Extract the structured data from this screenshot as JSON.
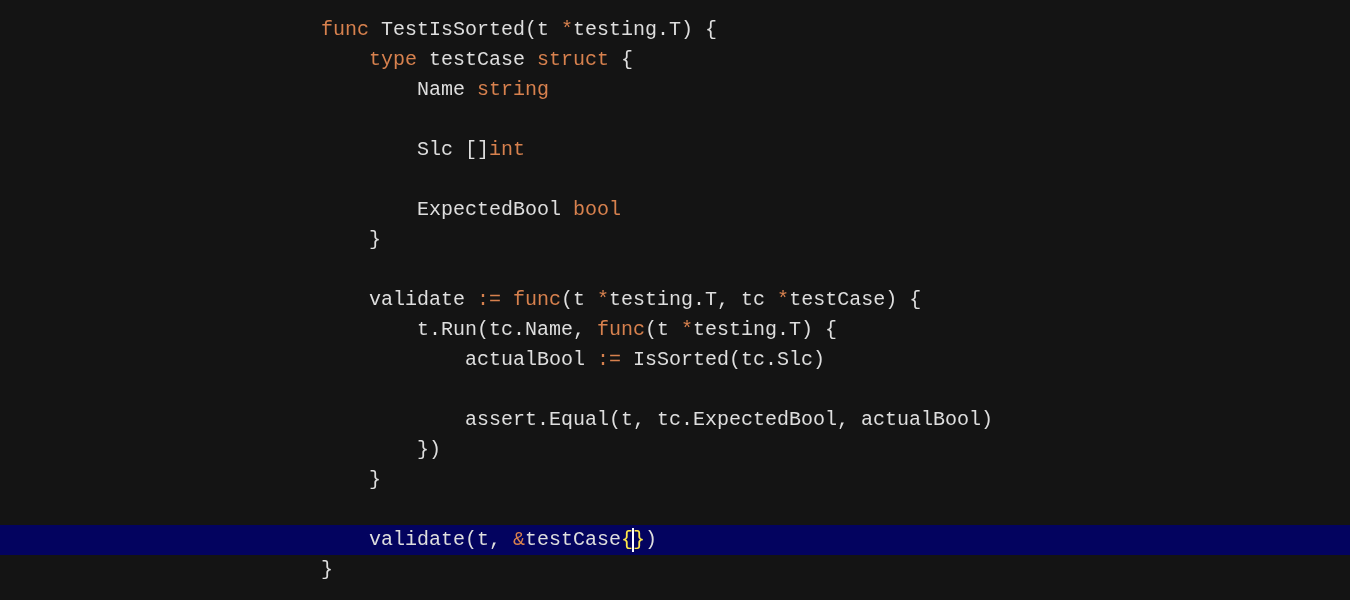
{
  "editor": {
    "lines": [
      {
        "current": false,
        "blank_before": false,
        "tokens": [
          {
            "kind": "keyword",
            "text": "func"
          },
          {
            "kind": "plain",
            "text": " TestIsSorted(t "
          },
          {
            "kind": "keyword",
            "text": "*"
          },
          {
            "kind": "plain",
            "text": "testing.T) {"
          }
        ],
        "children": [
          {
            "current": false,
            "blank_before": false,
            "tokens": [
              {
                "kind": "keyword",
                "text": "type"
              },
              {
                "kind": "plain",
                "text": " testCase "
              },
              {
                "kind": "keyword",
                "text": "struct"
              },
              {
                "kind": "plain",
                "text": " {"
              }
            ],
            "children": [
              {
                "current": false,
                "blank_before": false,
                "tokens": [
                  {
                    "kind": "plain",
                    "text": "Name "
                  },
                  {
                    "kind": "keyword",
                    "text": "string"
                  }
                ]
              },
              {
                "current": false,
                "blank_before": true,
                "tokens": [
                  {
                    "kind": "plain",
                    "text": "Slc []"
                  },
                  {
                    "kind": "keyword",
                    "text": "int"
                  }
                ]
              },
              {
                "current": false,
                "blank_before": true,
                "tokens": [
                  {
                    "kind": "plain",
                    "text": "ExpectedBool "
                  },
                  {
                    "kind": "keyword",
                    "text": "bool"
                  }
                ]
              }
            ]
          },
          {
            "current": false,
            "blank_before": false,
            "tokens": [
              {
                "kind": "plain",
                "text": "}"
              }
            ]
          },
          {
            "current": false,
            "blank_before": true,
            "tokens": [
              {
                "kind": "plain",
                "text": "validate "
              },
              {
                "kind": "keyword",
                "text": ":= func"
              },
              {
                "kind": "plain",
                "text": "(t "
              },
              {
                "kind": "keyword",
                "text": "*"
              },
              {
                "kind": "plain",
                "text": "testing.T, tc "
              },
              {
                "kind": "keyword",
                "text": "*"
              },
              {
                "kind": "plain",
                "text": "testCase) {"
              }
            ],
            "children": [
              {
                "current": false,
                "blank_before": false,
                "tokens": [
                  {
                    "kind": "plain",
                    "text": "t.Run(tc.Name, "
                  },
                  {
                    "kind": "keyword",
                    "text": "func"
                  },
                  {
                    "kind": "plain",
                    "text": "(t "
                  },
                  {
                    "kind": "keyword",
                    "text": "*"
                  },
                  {
                    "kind": "plain",
                    "text": "testing.T) {"
                  }
                ],
                "children": [
                  {
                    "current": false,
                    "blank_before": false,
                    "tokens": [
                      {
                        "kind": "plain",
                        "text": "actualBool "
                      },
                      {
                        "kind": "keyword",
                        "text": ":="
                      },
                      {
                        "kind": "plain",
                        "text": " IsSorted(tc.Slc)"
                      }
                    ]
                  },
                  {
                    "current": false,
                    "blank_before": true,
                    "tokens": [
                      {
                        "kind": "plain",
                        "text": "assert.Equal(t, tc.ExpectedBool, actualBool)"
                      }
                    ]
                  }
                ]
              },
              {
                "current": false,
                "blank_before": false,
                "tokens": [
                  {
                    "kind": "plain",
                    "text": "})"
                  }
                ]
              }
            ]
          },
          {
            "current": false,
            "blank_before": false,
            "tokens": [
              {
                "kind": "plain",
                "text": "}"
              }
            ]
          },
          {
            "current": true,
            "blank_before": true,
            "tokens": [
              {
                "kind": "plain",
                "text": "validate(t, "
              },
              {
                "kind": "keyword",
                "text": "&"
              },
              {
                "kind": "plain",
                "text": "testCase"
              },
              {
                "kind": "match",
                "text": "{"
              },
              {
                "kind": "caret"
              },
              {
                "kind": "match",
                "text": "}"
              },
              {
                "kind": "plain",
                "text": ")"
              }
            ]
          }
        ]
      },
      {
        "current": false,
        "blank_before": false,
        "tokens": [
          {
            "kind": "plain",
            "text": "}"
          }
        ]
      }
    ]
  }
}
